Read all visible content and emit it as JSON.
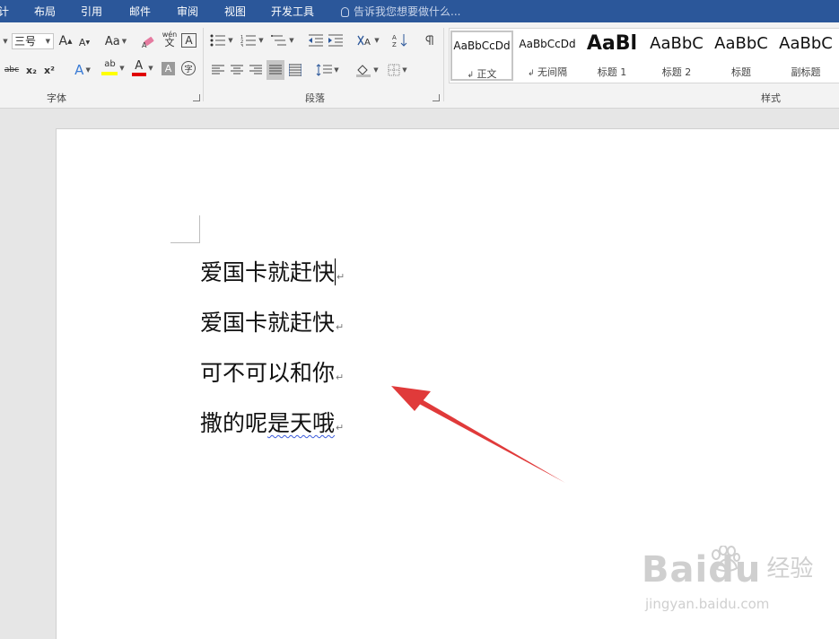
{
  "ribbon_tabs": [
    "计",
    "布局",
    "引用",
    "邮件",
    "审阅",
    "视图",
    "开发工具"
  ],
  "tell_me": "告诉我您想要做什么...",
  "font_group": {
    "label": "字体",
    "font_size": "三号",
    "grow_font": "A",
    "shrink_font": "A",
    "change_case": "Aa",
    "phonetic_top": "wén",
    "phonetic_bottom": "文",
    "char_border": "A",
    "strikethrough": "abc",
    "subscript": "x₂",
    "superscript": "x²",
    "text_effects": "A",
    "highlight": "ab",
    "font_color": "A",
    "char_shading": "A",
    "enclose": "字"
  },
  "paragraph_group": {
    "label": "段落"
  },
  "styles_group": {
    "label": "样式",
    "items": [
      {
        "preview": "AaBbCcDd",
        "name": "正文",
        "mark": "↲",
        "selected": true
      },
      {
        "preview": "AaBbCcDd",
        "name": "无间隔",
        "mark": "↲",
        "selected": false
      },
      {
        "preview": "AaBl",
        "name": "标题 1",
        "mark": "",
        "selected": false
      },
      {
        "preview": "AaBbC",
        "name": "标题 2",
        "mark": "",
        "selected": false
      },
      {
        "preview": "AaBbC",
        "name": "标题",
        "mark": "",
        "selected": false
      },
      {
        "preview": "AaBbC",
        "name": "副标题",
        "mark": "",
        "selected": false
      }
    ]
  },
  "document": {
    "lines": [
      "爱国卡就赶快",
      "爱国卡就赶快",
      "可不可以和你",
      "撒的呢是天哦"
    ],
    "paragraph_mark": "↵",
    "misspelled_part": "是天哦",
    "line4_prefix": "撒的呢"
  },
  "watermark": {
    "logo": "Baidu",
    "cn": "经验",
    "url": "jingyan.baidu.com"
  },
  "colors": {
    "ribbon_blue": "#2b579a",
    "arrow_red": "#e03a3a",
    "highlight_yellow": "#ffff00",
    "font_red": "#e00000"
  }
}
